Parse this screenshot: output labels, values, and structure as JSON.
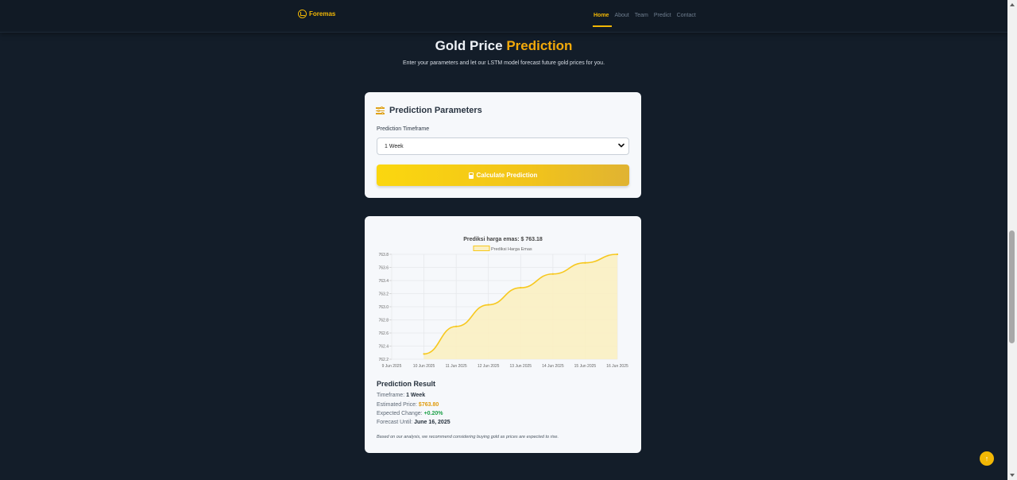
{
  "nav": {
    "brand": "Foremas",
    "links": [
      "Home",
      "About",
      "Team",
      "Predict",
      "Contact"
    ],
    "active": "Home"
  },
  "hero": {
    "title_main": "Gold Price ",
    "title_accent": "Prediction",
    "subtitle": "Enter your parameters and let our LSTM model forecast future gold prices for you."
  },
  "params": {
    "title": "Prediction Parameters",
    "timeframe_label": "Prediction Timeframe",
    "timeframe_value": "1 Week",
    "button_label": "Calculate Prediction"
  },
  "chart_data": {
    "type": "area",
    "title": "Prediksi harga emas: $ 763.18",
    "legend": [
      "Prediksi Harga Emas"
    ],
    "legend_position": "top",
    "x": [
      "9 Jun 2025",
      "10 Jun 2025",
      "11 Jun 2025",
      "12 Jun 2025",
      "13 Jun 2025",
      "14 Jun 2025",
      "15 Jun 2025",
      "16 Jun 2025"
    ],
    "series": [
      {
        "name": "Prediksi Harga Emas",
        "x": [
          "10 Jun 2025",
          "11 Jun 2025",
          "12 Jun 2025",
          "13 Jun 2025",
          "14 Jun 2025",
          "15 Jun 2025",
          "16 Jun 2025"
        ],
        "values": [
          762.28,
          762.7,
          763.03,
          763.29,
          763.5,
          763.67,
          763.8
        ]
      }
    ],
    "ylim": [
      762.2,
      763.8
    ],
    "yticks": [
      "763.8",
      "763.6",
      "763.4",
      "763.2",
      "763.0",
      "762.8",
      "762.6",
      "762.4",
      "762.2"
    ],
    "grid": true,
    "colors": {
      "line": "#f7c81e",
      "fill": "#fbf0c2"
    }
  },
  "result": {
    "title": "Prediction Result",
    "timeframe_label": "Timeframe:",
    "timeframe_value": "1 Week",
    "price_label": "Estimated Price:",
    "price_value": "$763.80",
    "change_label": "Expected Change:",
    "change_value": "+0.20%",
    "until_label": "Forecast Until:",
    "until_value": "June 16, 2025",
    "note": "Based on our analysis, we recommend considering buying gold as prices are expected to rise."
  },
  "fab_icon": "arrow-up-icon"
}
